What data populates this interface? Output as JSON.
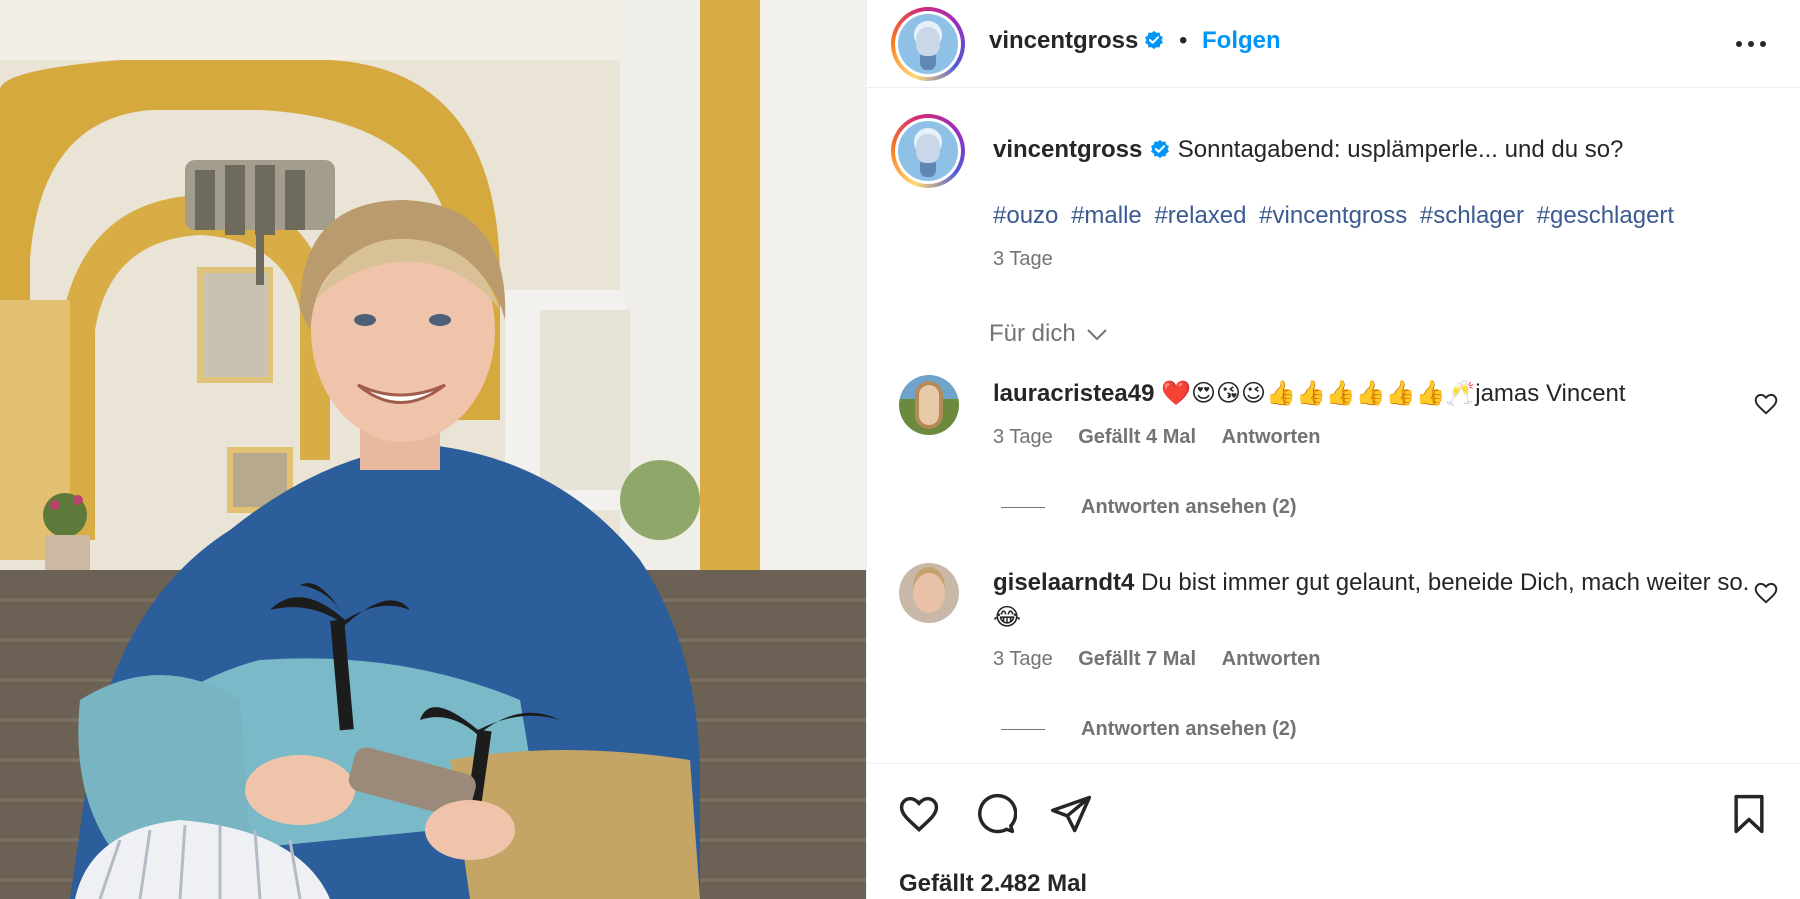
{
  "post": {
    "username": "vincentgross",
    "follow_label": "Folgen",
    "separator": "•",
    "caption": "Sonntagabend: usplämperle... und du so?",
    "hashtags": [
      "#ouzo",
      "#malle",
      "#relaxed",
      "#vincentgross",
      "#schlager",
      "#geschlagert"
    ],
    "caption_time": "3 Tage",
    "for_you_label": "Für dich",
    "likes_text": "Gefällt 2.482 Mal"
  },
  "comments": [
    {
      "username": "lauracristea49",
      "emoji": "❤️😍😘😉👍👍👍👍👍👍🥂",
      "text": "jamas Vincent",
      "time": "3 Tage",
      "likes": "Gefällt 4 Mal",
      "reply_label": "Antworten",
      "view_replies": "Antworten ansehen (2)"
    },
    {
      "username": "giselaarndt4",
      "text": "Du bist immer gut gelaunt, beneide Dich, mach weiter so.",
      "emoji": "😂",
      "time": "3 Tage",
      "likes": "Gefällt 7 Mal",
      "reply_label": "Antworten",
      "view_replies": "Antworten ansehen (2)"
    }
  ],
  "icons": {
    "verified": "verified-badge-icon",
    "more": "more-options-icon",
    "chevron": "chevron-down-icon",
    "heart": "heart-icon",
    "comment": "comment-icon",
    "share": "share-icon",
    "save": "bookmark-icon"
  },
  "colors": {
    "follow": "#0095f6",
    "hashtag": "#3b5a91",
    "verified": "#0095f6",
    "comment_heart": "#ed4956"
  }
}
